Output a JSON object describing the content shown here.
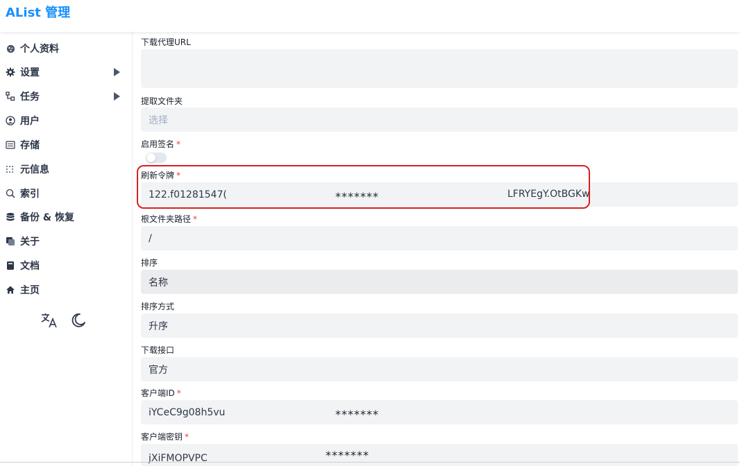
{
  "app": {
    "title": "AList 管理"
  },
  "sidebar": {
    "items": [
      {
        "label": "个人资料",
        "icon": "profile-icon"
      },
      {
        "label": "设置",
        "icon": "gear-icon",
        "expandable": true
      },
      {
        "label": "任务",
        "icon": "tasks-icon",
        "expandable": true
      },
      {
        "label": "用户",
        "icon": "user-icon"
      },
      {
        "label": "存储",
        "icon": "storage-icon"
      },
      {
        "label": "元信息",
        "icon": "meta-icon"
      },
      {
        "label": "索引",
        "icon": "search-icon"
      },
      {
        "label": "备份 & 恢复",
        "icon": "database-icon"
      },
      {
        "label": "关于",
        "icon": "about-icon"
      },
      {
        "label": "文档",
        "icon": "book-icon"
      },
      {
        "label": "主页",
        "icon": "home-icon"
      }
    ],
    "tools": [
      {
        "name": "language-icon"
      },
      {
        "name": "moon-icon"
      }
    ]
  },
  "form": {
    "download_proxy_url": {
      "label": "下载代理URL",
      "value": ""
    },
    "extract_folder": {
      "label": "提取文件夹",
      "placeholder": "选择"
    },
    "enable_sign": {
      "label": "启用签名",
      "required": "*",
      "enabled": false
    },
    "refresh_token": {
      "label": "刷新令牌",
      "required": "*",
      "value_start": "122.f01281547(",
      "mask": "*******",
      "value_end": "LFRYEgY.OtBGKw"
    },
    "root_folder_path": {
      "label": "根文件夹路径",
      "required": "*",
      "value": "/"
    },
    "order_by": {
      "label": "排序",
      "value": "名称"
    },
    "order_direction": {
      "label": "排序方式",
      "value": "升序"
    },
    "download_api": {
      "label": "下载接口",
      "value": "官方"
    },
    "client_id": {
      "label": "客户端ID",
      "required": "*",
      "value_start": "iYCeC9g08h5vu",
      "mask": "*******"
    },
    "client_secret": {
      "label": "客户端密钥",
      "required": "*",
      "value_start": "jXiFMOPVPC",
      "mask": "*******"
    }
  },
  "colors": {
    "brand": "#1890ff",
    "required": "#e53e3e",
    "highlight": "#d61f1f",
    "input_bg": "#f2f3f5"
  }
}
